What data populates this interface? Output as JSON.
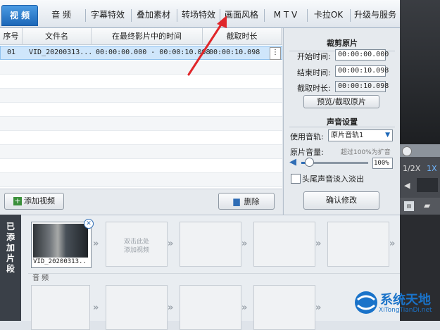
{
  "tabs": [
    {
      "label": "视 频",
      "active": true
    },
    {
      "label": "音 频"
    },
    {
      "label": "字幕特效"
    },
    {
      "label": "叠加素材"
    },
    {
      "label": "转场特效"
    },
    {
      "label": "画面风格"
    },
    {
      "label": "M T V"
    },
    {
      "label": "卡拉OK"
    },
    {
      "label": "升级与服务"
    }
  ],
  "table": {
    "headers": [
      "序号",
      "文件名",
      "在最终影片中的时间",
      "截取时长"
    ],
    "rows": [
      {
        "index": "01",
        "filename": "VID_20200313...",
        "time": "00:00:00.000 - 00:00:10.098",
        "duration": "00:00:10.098",
        "menu": "⋮"
      }
    ]
  },
  "settings": {
    "crop_title": "裁剪原片",
    "start_label": "开始时间:",
    "start_value": "00:00:00.000",
    "end_label": "结束时间:",
    "end_value": "00:00:10.098",
    "dur_label": "截取时长:",
    "dur_value": "00:00:10.098",
    "preview_button": "预览/截取原片",
    "sound_title": "声音设置",
    "track_label": "使用音轨:",
    "track_value": "原片音轨1",
    "volume_label": "原片音量:",
    "volume_hint": "超过100%为扩音",
    "volume_value": "100%",
    "fade_label": "头尾声音淡入淡出",
    "confirm_button": "确认修改"
  },
  "listbar": {
    "add_label": "添加视频",
    "delete_label": "删除"
  },
  "preview": {
    "speed_half": "1/2X",
    "speed_one": "1X"
  },
  "timeline": {
    "side_label": [
      "已",
      "添",
      "加",
      "片",
      "段"
    ],
    "clip_name": "VID_20200313...",
    "placeholder": [
      "双击此处",
      "添加视频"
    ],
    "audio_label": "音 频"
  },
  "watermark": {
    "name": "系统天地",
    "url": "XiTongTianDi.net"
  },
  "colors": {
    "tab_active": "#1c67b8",
    "row_selected": "#cfe6fb",
    "arrow_red": "#e0262a"
  }
}
